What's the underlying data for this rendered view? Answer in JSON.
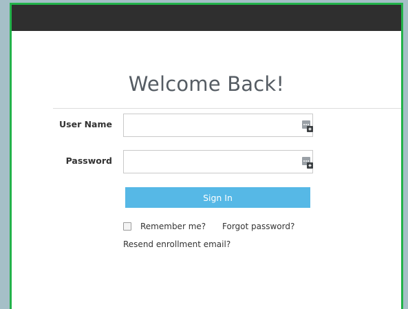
{
  "window": {
    "border_color": "#22b24a",
    "topbar_color": "#2f2f2f"
  },
  "login": {
    "title": "Welcome Back!",
    "username": {
      "label": "User Name",
      "value": "",
      "placeholder": ""
    },
    "password": {
      "label": "Password",
      "value": "",
      "placeholder": ""
    },
    "password_manager_icon": "password-manager-icon",
    "signin_label": "Sign In",
    "signin_color": "#56b8e6",
    "remember_label": "Remember me?",
    "remember_checked": false,
    "forgot_label": "Forgot password?",
    "resend_label": "Resend enrollment email?"
  }
}
